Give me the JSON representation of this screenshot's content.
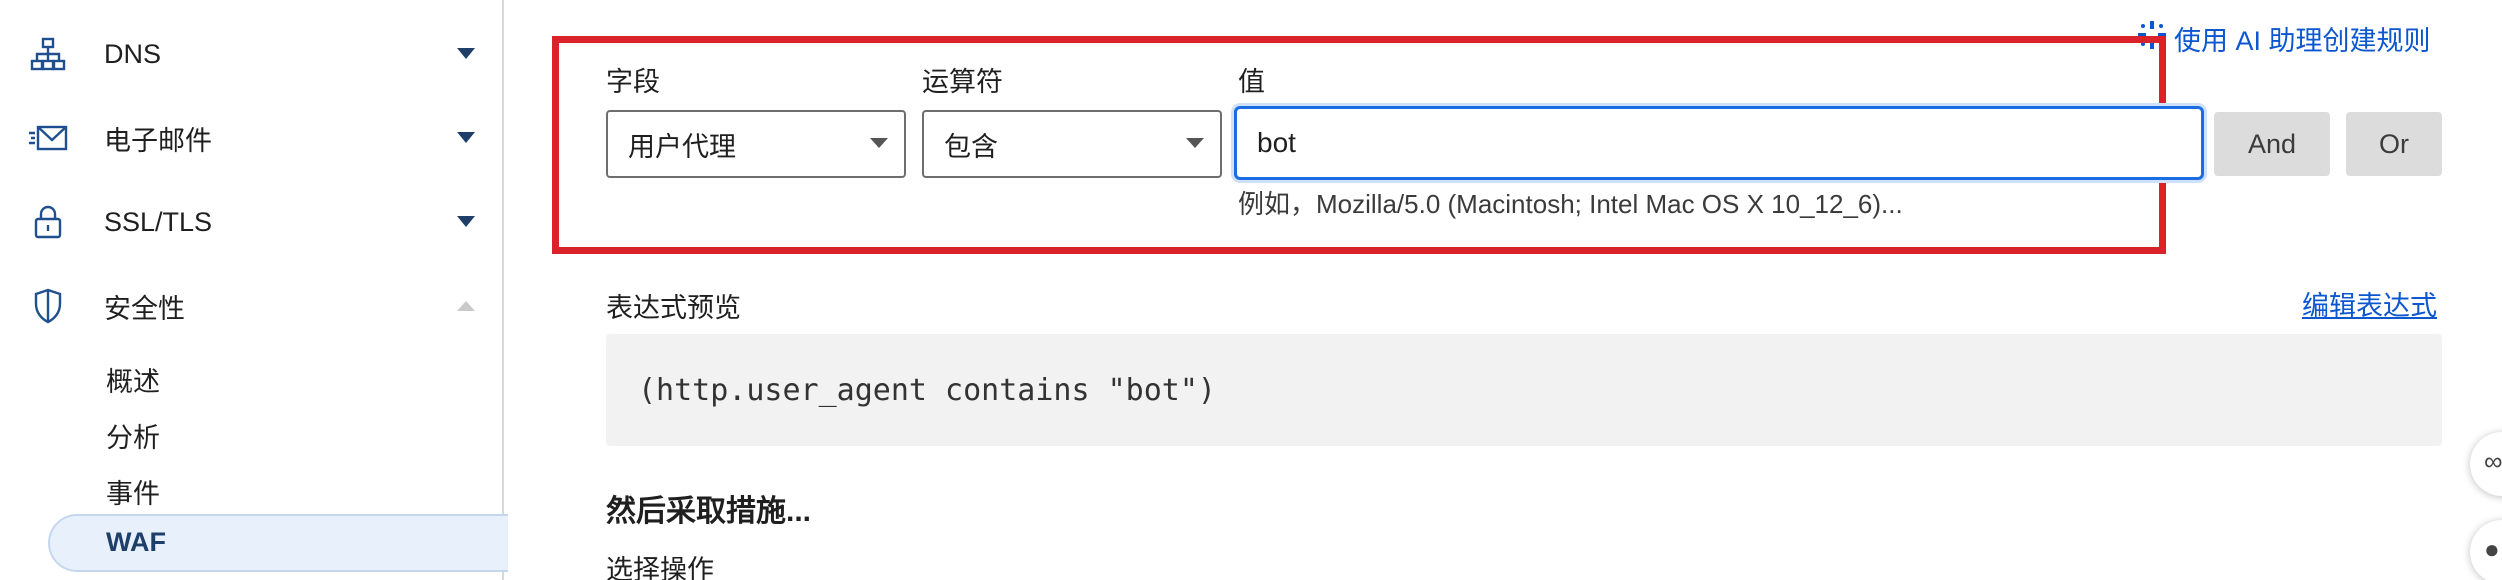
{
  "sidebar": {
    "items": [
      {
        "label": "DNS",
        "icon": "network-icon",
        "expanded": false
      },
      {
        "label": "电子邮件",
        "icon": "email-icon",
        "expanded": false
      },
      {
        "label": "SSL/TLS",
        "icon": "lock-icon",
        "expanded": false
      },
      {
        "label": "安全性",
        "icon": "shield-icon",
        "expanded": true
      }
    ],
    "security_subitems": [
      "概述",
      "分析",
      "事件",
      "WAF"
    ],
    "active_subitem": "WAF"
  },
  "ai_assist": {
    "label": "使用 AI 助理创建规则",
    "icon": "sparkle-icon"
  },
  "rule": {
    "field_label": "字段",
    "field_value": "用户代理",
    "operator_label": "运算符",
    "operator_value": "包含",
    "value_label": "值",
    "value": "bot",
    "value_hint": "例如，Mozilla/5.0 (Macintosh; Intel Mac OS X 10_12_6)...",
    "and_label": "And",
    "or_label": "Or"
  },
  "expression": {
    "label": "表达式预览",
    "edit_label": "编辑表达式",
    "code": "(http.user_agent contains \"bot\")"
  },
  "action": {
    "title": "然后采取措施...",
    "choose_label": "选择操作"
  },
  "colors": {
    "accent": "#0b57d0",
    "highlight": "#d9222a",
    "active_bg": "#e8f0fb"
  }
}
